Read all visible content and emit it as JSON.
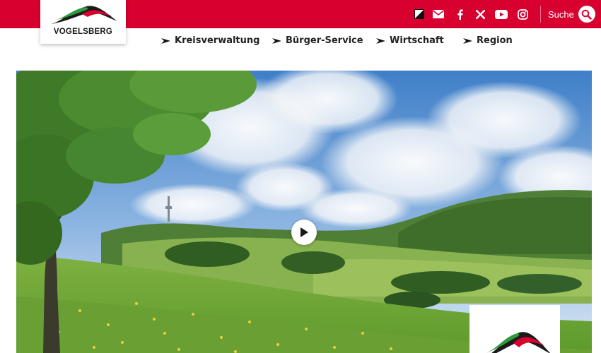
{
  "brand": {
    "name": "VOGELSBERG",
    "logo_icon": "vogelsberg-logo-icon",
    "colors": {
      "red": "#d7002f",
      "green": "#2e9a3c",
      "dark": "#1a1a1a"
    }
  },
  "topbar": {
    "icons": [
      "contrast-icon",
      "mail-icon",
      "facebook-icon",
      "x-icon",
      "youtube-icon",
      "instagram-icon"
    ],
    "search_label": "Suche",
    "search_icon": "search-icon"
  },
  "nav": {
    "items": [
      {
        "label": "Kreisverwaltung"
      },
      {
        "label": "Bürger-Service"
      },
      {
        "label": "Wirtschaft"
      },
      {
        "label": "Region"
      }
    ],
    "arrow_icon": "arrow-right-icon"
  },
  "hero": {
    "image": "landscape-photo-meadow-hills",
    "play_icon": "play-icon"
  }
}
